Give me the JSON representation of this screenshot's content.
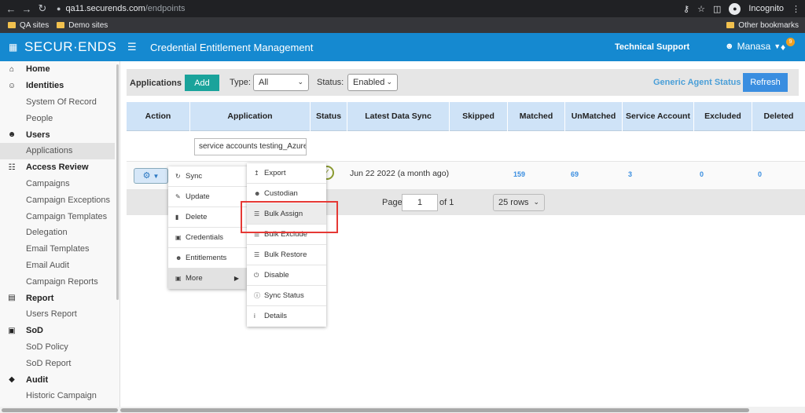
{
  "browser": {
    "url_host": "qa11.securends.com",
    "url_path": "/endpoints",
    "incognito_label": "Incognito",
    "bookmarks": [
      "QA sites",
      "Demo sites"
    ],
    "other_bookmarks": "Other bookmarks"
  },
  "header": {
    "logo": "SECUR·ENDS",
    "title": "Credential Entitlement Management",
    "tech_support": "Technical Support",
    "user": "Manasa",
    "notification_count": "9"
  },
  "sidebar": {
    "items": [
      {
        "label": "Home",
        "type": "head",
        "icon": "home-icon"
      },
      {
        "label": "Identities",
        "type": "head",
        "icon": "people-icon"
      },
      {
        "label": "System Of Record",
        "type": "sub"
      },
      {
        "label": "People",
        "type": "sub"
      },
      {
        "label": "Users",
        "type": "head",
        "icon": "user-icon"
      },
      {
        "label": "Applications",
        "type": "sub",
        "active": true
      },
      {
        "label": "Access Review",
        "type": "head",
        "icon": "grid-icon"
      },
      {
        "label": "Campaigns",
        "type": "sub"
      },
      {
        "label": "Campaign Exceptions",
        "type": "sub"
      },
      {
        "label": "Campaign Templates",
        "type": "sub"
      },
      {
        "label": "Delegation",
        "type": "sub"
      },
      {
        "label": "Email Templates",
        "type": "sub"
      },
      {
        "label": "Email Audit",
        "type": "sub"
      },
      {
        "label": "Campaign Reports",
        "type": "sub"
      },
      {
        "label": "Report",
        "type": "head",
        "icon": "report-icon"
      },
      {
        "label": "Users Report",
        "type": "sub"
      },
      {
        "label": "SoD",
        "type": "head",
        "icon": "sod-icon"
      },
      {
        "label": "SoD Policy",
        "type": "sub"
      },
      {
        "label": "SoD Report",
        "type": "sub"
      },
      {
        "label": "Audit",
        "type": "head",
        "icon": "shield-icon"
      },
      {
        "label": "Historic Campaign",
        "type": "sub"
      }
    ]
  },
  "toolbar": {
    "label": "Applications",
    "add": "Add",
    "type_label": "Type:",
    "type_value": "All",
    "status_label": "Status:",
    "status_value": "Enabled",
    "generic_agent_status": "Generic Agent Status",
    "refresh": "Refresh"
  },
  "table": {
    "columns": [
      "Action",
      "Application",
      "Status",
      "Latest Data Sync",
      "Skipped",
      "Matched",
      "UnMatched",
      "Service Account",
      "Excluded",
      "Deleted"
    ],
    "filter_application": "service accounts testing_Azure",
    "row": {
      "latest_sync": "Jun 22 2022 (a month ago)",
      "matched": "159",
      "unmatched": "69",
      "service_account": "3",
      "excluded": "0",
      "deleted": "0"
    }
  },
  "pager": {
    "page_label": "Page",
    "page": "1",
    "of": "of 1",
    "rows": "25 rows"
  },
  "action_menu": [
    "Sync",
    "Update",
    "Delete",
    "Credentials",
    "Entitlements",
    "More"
  ],
  "more_menu": [
    "Export",
    "Custodian",
    "Bulk Assign",
    "Bulk Exclude",
    "Bulk Restore",
    "Disable",
    "Sync Status",
    "Details"
  ]
}
